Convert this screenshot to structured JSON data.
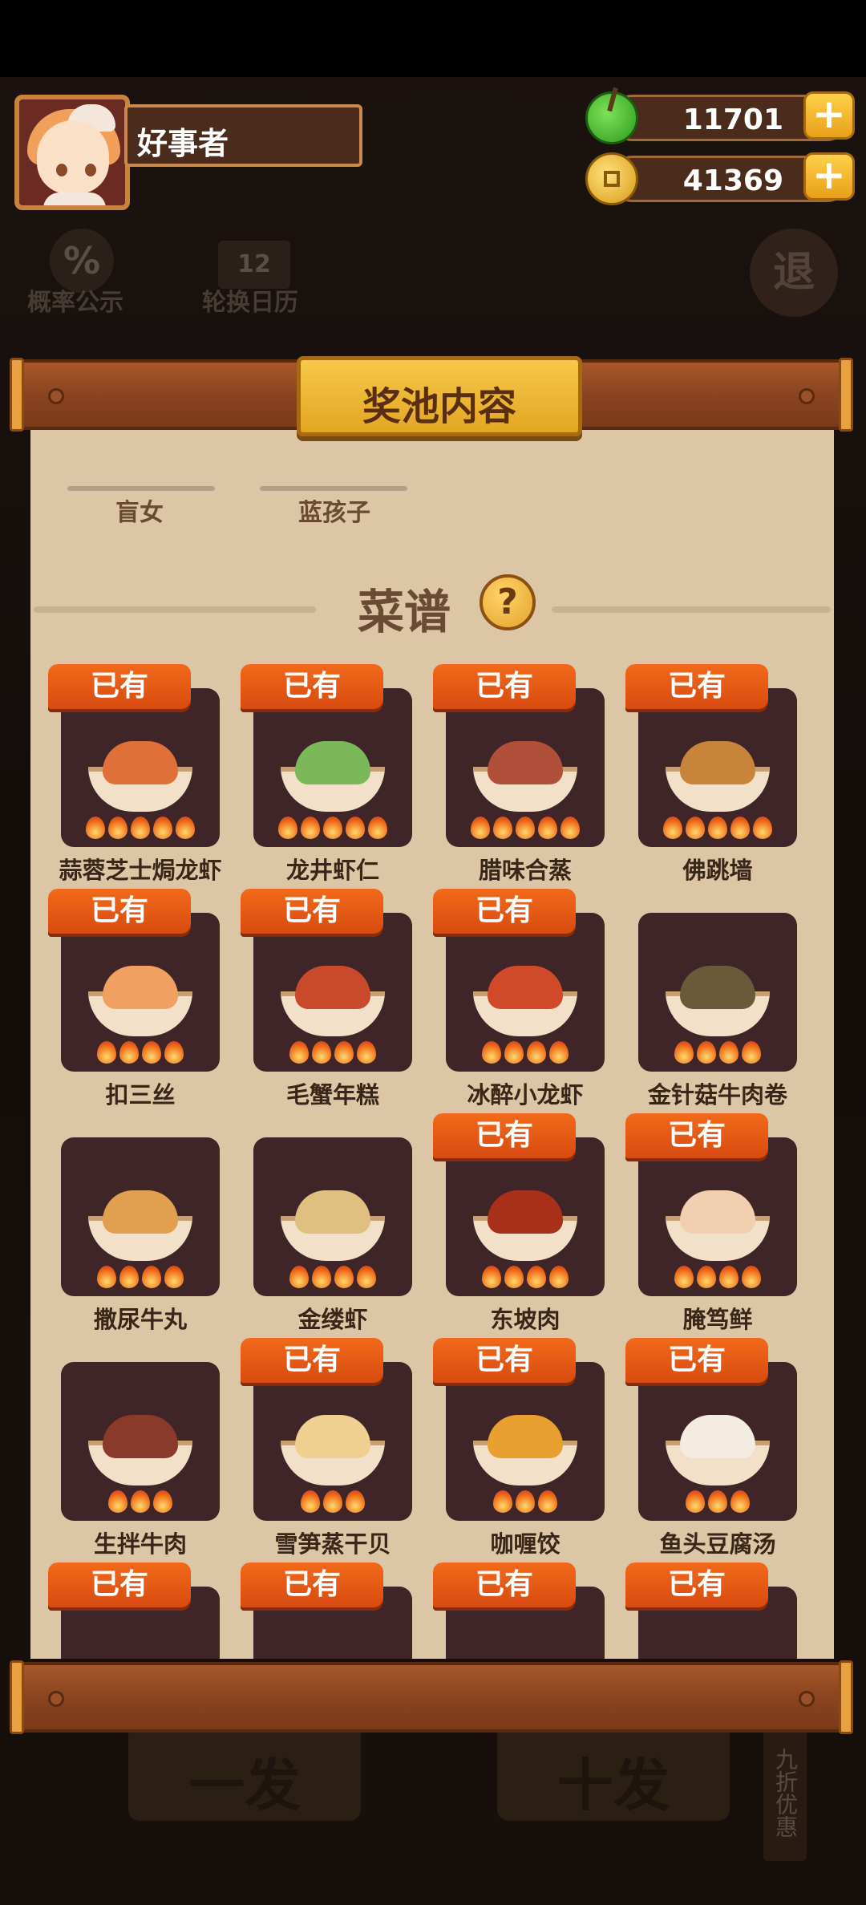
{
  "header": {
    "player_name": "好事者",
    "currency": [
      {
        "icon": "green-fruit-icon",
        "amount": "11701"
      },
      {
        "icon": "gold-coin-icon",
        "amount": "41369"
      }
    ],
    "plus_label": "+"
  },
  "background_menu": {
    "probability": {
      "icon": "%",
      "label": "概率公示"
    },
    "calendar": {
      "icon": "12",
      "label": "轮换日历"
    },
    "exit_label": "退",
    "bottom_left": "一发",
    "bottom_right": "十发",
    "side_tag": "九折优惠"
  },
  "panel": {
    "title": "奖池内容",
    "characters": [
      "盲女",
      "蓝孩子"
    ],
    "section_title": "菜谱",
    "help_label": "?",
    "owned_label": "已有",
    "recipes": [
      {
        "name": "蒜蓉芝士焗龙虾",
        "owned": true,
        "stars": 5,
        "color": "#e0703a"
      },
      {
        "name": "龙井虾仁",
        "owned": true,
        "stars": 5,
        "color": "#7ab85a"
      },
      {
        "name": "腊味合蒸",
        "owned": true,
        "stars": 5,
        "color": "#b0503a"
      },
      {
        "name": "佛跳墙",
        "owned": true,
        "stars": 5,
        "color": "#c8843a"
      },
      {
        "name": "扣三丝",
        "owned": true,
        "stars": 4,
        "color": "#f0a060"
      },
      {
        "name": "毛蟹年糕",
        "owned": true,
        "stars": 4,
        "color": "#c84a2a"
      },
      {
        "name": "冰醉小龙虾",
        "owned": true,
        "stars": 4,
        "color": "#d04a2a"
      },
      {
        "name": "金针菇牛肉卷",
        "owned": false,
        "stars": 4,
        "color": "#6a5a3a"
      },
      {
        "name": "撒尿牛丸",
        "owned": false,
        "stars": 4,
        "color": "#e0a050"
      },
      {
        "name": "金缕虾",
        "owned": false,
        "stars": 4,
        "color": "#e0c080"
      },
      {
        "name": "东坡肉",
        "owned": true,
        "stars": 4,
        "color": "#a8301a"
      },
      {
        "name": "腌笃鲜",
        "owned": true,
        "stars": 4,
        "color": "#f0d0b0"
      },
      {
        "name": "生拌牛肉",
        "owned": false,
        "stars": 3,
        "color": "#8a3a2a"
      },
      {
        "name": "雪笋蒸干贝",
        "owned": true,
        "stars": 3,
        "color": "#f0d090"
      },
      {
        "name": "咖喱饺",
        "owned": true,
        "stars": 3,
        "color": "#e8a030"
      },
      {
        "name": "鱼头豆腐汤",
        "owned": true,
        "stars": 3,
        "color": "#f4ece0"
      }
    ],
    "partial_row_owned": [
      true,
      true,
      true,
      true
    ]
  }
}
